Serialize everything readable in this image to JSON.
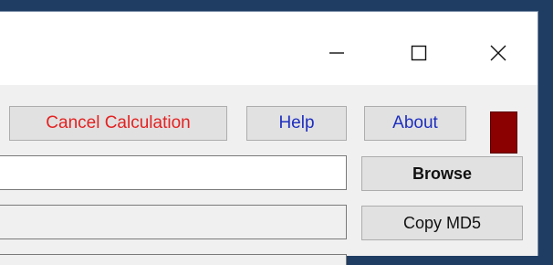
{
  "window": {
    "controls": {
      "minimize_icon": "minimize-icon",
      "maximize_icon": "maximize-icon",
      "close_icon": "close-icon"
    }
  },
  "toolbar": {
    "cancel_label": "Cancel Calculation",
    "help_label": "Help",
    "about_label": "About"
  },
  "status_indicator": {
    "color": "#8b0000"
  },
  "inputs": {
    "file_path_value": "",
    "md5_value": ""
  },
  "actions": {
    "browse_label": "Browse",
    "copy_md5_label": "Copy MD5"
  },
  "colors": {
    "cancel_text": "#e32222",
    "link_text": "#1f2fbf",
    "window_bg": "#f0f0f0",
    "desktop_bg": "#1f3d63"
  }
}
